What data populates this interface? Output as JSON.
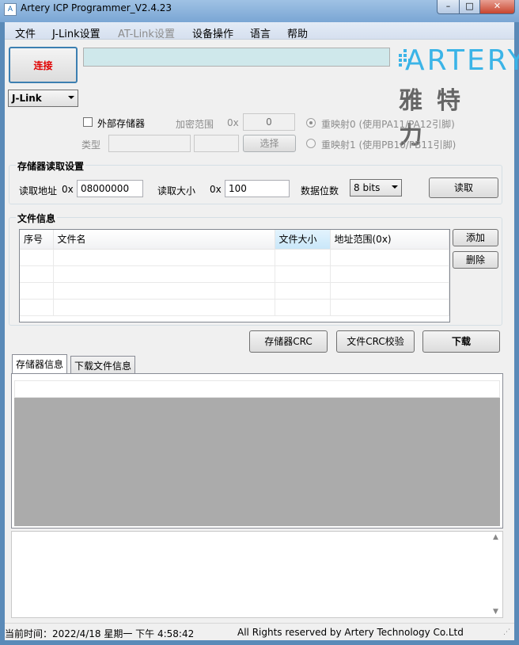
{
  "window": {
    "title": "Artery ICP Programmer_V2.4.23",
    "icon_name": "app-icon",
    "min": "–",
    "max": "□",
    "close": "✕"
  },
  "menu": {
    "items": [
      "文件",
      "J-Link设置",
      "AT-Link设置",
      "设备操作",
      "语言",
      "帮助"
    ]
  },
  "connect": {
    "label": "连接",
    "color": "#e00000"
  },
  "device_combo": {
    "value": "J-Link"
  },
  "logo": {
    "text": "ARTERY",
    "cn": "雅特力"
  },
  "ext_memory": {
    "checkbox_label": "外部存储器",
    "checked": false,
    "range_label": "加密范围",
    "range_prefix": "0x",
    "range_value": "0",
    "type_label": "类型",
    "select_button": "选择",
    "remap0": "重映射0 (使用PA11/PA12引脚)",
    "remap1": "重映射1 (使用PB10/PB11引脚)"
  },
  "read_settings": {
    "title": "存储器读取设置",
    "addr_label": "读取地址",
    "addr_prefix": "0x",
    "addr_value": "08000000",
    "size_label": "读取大小",
    "size_prefix": "0x",
    "size_value": "100",
    "bits_label": "数据位数",
    "bits_value": "8 bits",
    "read_button": "读取"
  },
  "file_info": {
    "title": "文件信息",
    "columns": [
      "序号",
      "文件名",
      "文件大小",
      "地址范围(0x)"
    ],
    "rows": [],
    "add_button": "添加",
    "delete_button": "删除"
  },
  "actions": {
    "crc_button": "存储器CRC",
    "file_crc_button": "文件CRC校验",
    "download_button": "下载"
  },
  "tabs": [
    "存储器信息",
    "下载文件信息"
  ],
  "status": {
    "time": "当前时间：2022/4/18 星期一 下午 4:58:42",
    "copyright": "All Rights reserved by Artery Technology Co.Ltd"
  },
  "colors": {
    "accent": "#3bb4e7",
    "progress": "#cfe8eb"
  }
}
